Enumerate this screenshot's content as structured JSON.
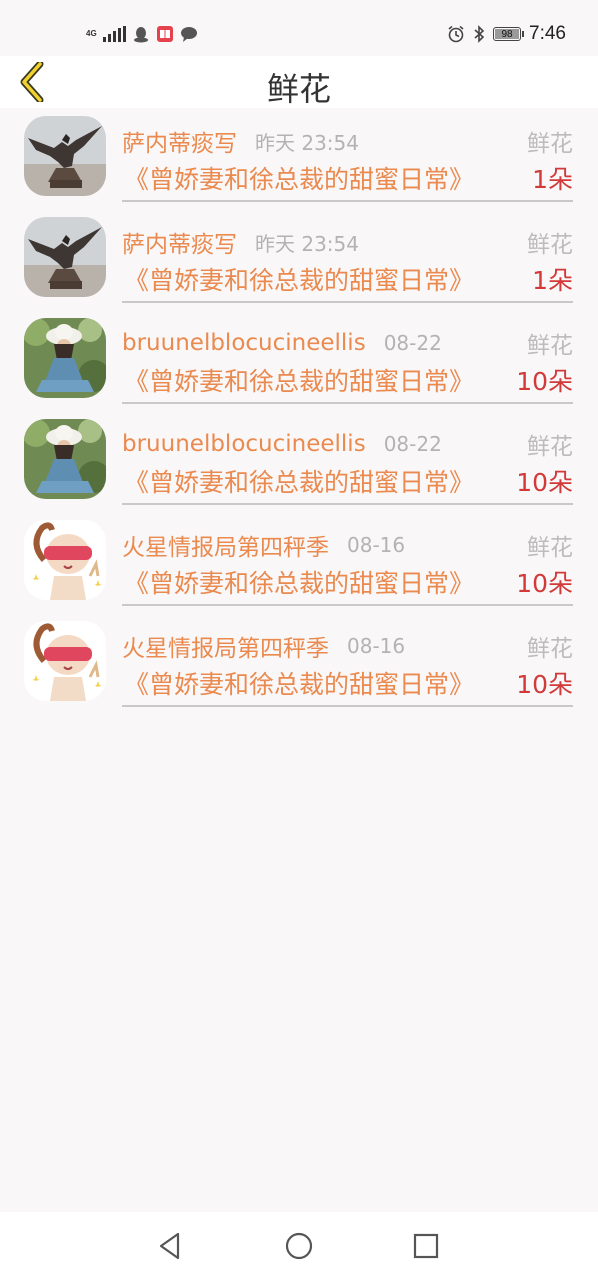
{
  "status_bar": {
    "network": [
      "4G",
      "4G"
    ],
    "battery": "98",
    "battery_level": 0.98,
    "time": "7:46"
  },
  "header": {
    "title": "鲜花"
  },
  "colors": {
    "accent": "#ea8a4f",
    "count": "#d23a3a",
    "muted": "#b3b3b3"
  },
  "records": [
    {
      "name": "萨内蒂痰写",
      "time": "昨天 23:54",
      "gift": "鲜花",
      "book": "《曾娇妻和徐总裁的甜蜜日常》",
      "count": "1朵",
      "avatar": "eagle-statue"
    },
    {
      "name": "萨内蒂痰写",
      "time": "昨天 23:54",
      "gift": "鲜花",
      "book": "《曾娇妻和徐总裁的甜蜜日常》",
      "count": "1朵",
      "avatar": "eagle-statue"
    },
    {
      "name": "bruunelblocucineellis",
      "time": "08-22",
      "gift": "鲜花",
      "book": "《曾娇妻和徐总裁的甜蜜日常》",
      "count": "10朵",
      "avatar": "girl-in-hat"
    },
    {
      "name": "bruunelblocucineellis",
      "time": "08-22",
      "gift": "鲜花",
      "book": "《曾娇妻和徐总裁的甜蜜日常》",
      "count": "10朵",
      "avatar": "girl-in-hat"
    },
    {
      "name": "火星情报局第四秤季",
      "time": "08-16",
      "gift": "鲜花",
      "book": "《曾娇妻和徐总裁的甜蜜日常》",
      "count": "10朵",
      "avatar": "cartoon-blindfold"
    },
    {
      "name": "火星情报局第四秤季",
      "time": "08-16",
      "gift": "鲜花",
      "book": "《曾娇妻和徐总裁的甜蜜日常》",
      "count": "10朵",
      "avatar": "cartoon-blindfold"
    }
  ],
  "nav": {
    "back_icon": "triangle-back-icon",
    "home_icon": "circle-home-icon",
    "recents_icon": "square-recents-icon"
  }
}
